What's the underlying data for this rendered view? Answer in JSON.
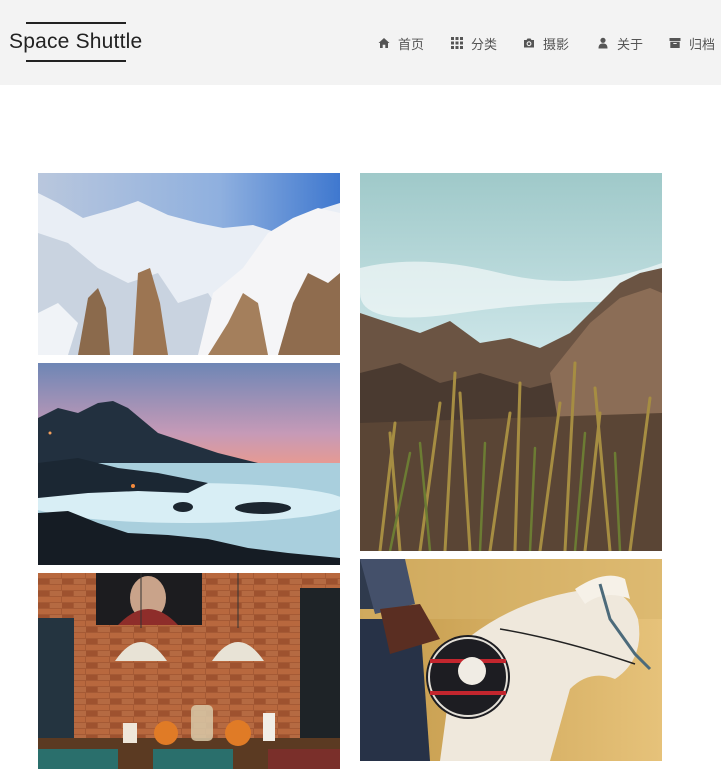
{
  "site": {
    "title": "Space Shuttle"
  },
  "nav": [
    {
      "label": "首页",
      "icon": "home-icon"
    },
    {
      "label": "分类",
      "icon": "grid-icon"
    },
    {
      "label": "摄影",
      "icon": "camera-icon"
    },
    {
      "label": "关于",
      "icon": "user-icon"
    },
    {
      "label": "归档",
      "icon": "archive-icon"
    }
  ],
  "gallery": [
    {
      "subject": "snowy-mountains"
    },
    {
      "subject": "rocky-desert-grass"
    },
    {
      "subject": "misty-coast-sunset"
    },
    {
      "subject": "brick-wall-dining-room"
    },
    {
      "subject": "rider-white-horse"
    }
  ]
}
